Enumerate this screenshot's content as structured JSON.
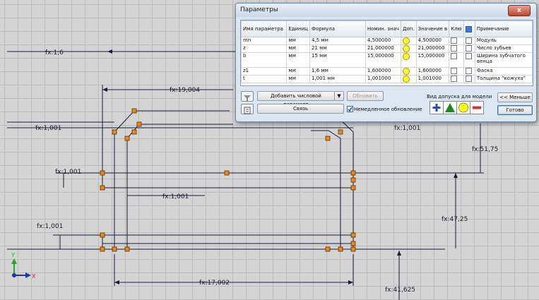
{
  "dialog": {
    "title": "Параметры",
    "close_label": "x",
    "columns": [
      "Имя параметра",
      "Единиц",
      "Формула",
      "Номин. знач",
      "Доп.",
      "Значение в",
      "Клю",
      "",
      "Примечание"
    ],
    "rows": [
      {
        "name": "mn",
        "unit": "мм",
        "formula": "4,5 мм",
        "nominal": "4,500000",
        "model_value": "4,500000",
        "note": "Модуль"
      },
      {
        "name": "z",
        "unit": "мм",
        "formula": "21 мм",
        "nominal": "21,000000",
        "model_value": "21,000000",
        "note": "Число зубьев"
      },
      {
        "name": "b",
        "unit": "мм",
        "formula": "15 мм",
        "nominal": "15,000000",
        "model_value": "15,000000",
        "note": "Ширина зубчатого венца"
      },
      {
        "name": "z1",
        "unit": "мм",
        "formula": "1,6 мм",
        "nominal": "1,600000",
        "model_value": "1,600000",
        "note": "Фаска"
      },
      {
        "name": "t",
        "unit": "мм",
        "formula": "1,001 мм",
        "nominal": "1,001000",
        "model_value": "1,001000",
        "note": "Толщина \"кожуха\""
      }
    ],
    "add_param_label": "Добавить числовой параметр",
    "update_label": "Обновить",
    "link_label": "Связь",
    "immediate_update_label": "Немедленное обновление",
    "tolerance_label": "Вид допуска для модели",
    "less_label": "<< Меньше",
    "done_label": "Готово",
    "filter_icon": "filter-icon",
    "export_icon": "export-icon"
  },
  "sketch": {
    "dimensions": [
      "fx:1,6",
      "fx:19,004",
      "fx:1,001",
      "fx:1,001",
      "fx:1,001",
      "fx:1,001",
      "fx:1,001",
      "fx:51,75",
      "fx:47,25",
      "fx:17,002",
      "fx:41,625"
    ],
    "axis_x": "X",
    "axis_y": "Y"
  },
  "colors": {
    "accent_blue": "#1f4fd6",
    "tolerance_green": "#1c8a1c",
    "tolerance_yellow": "#ffff20",
    "tolerance_red": "#d8302a",
    "sketch_point": "#e88a1a"
  }
}
